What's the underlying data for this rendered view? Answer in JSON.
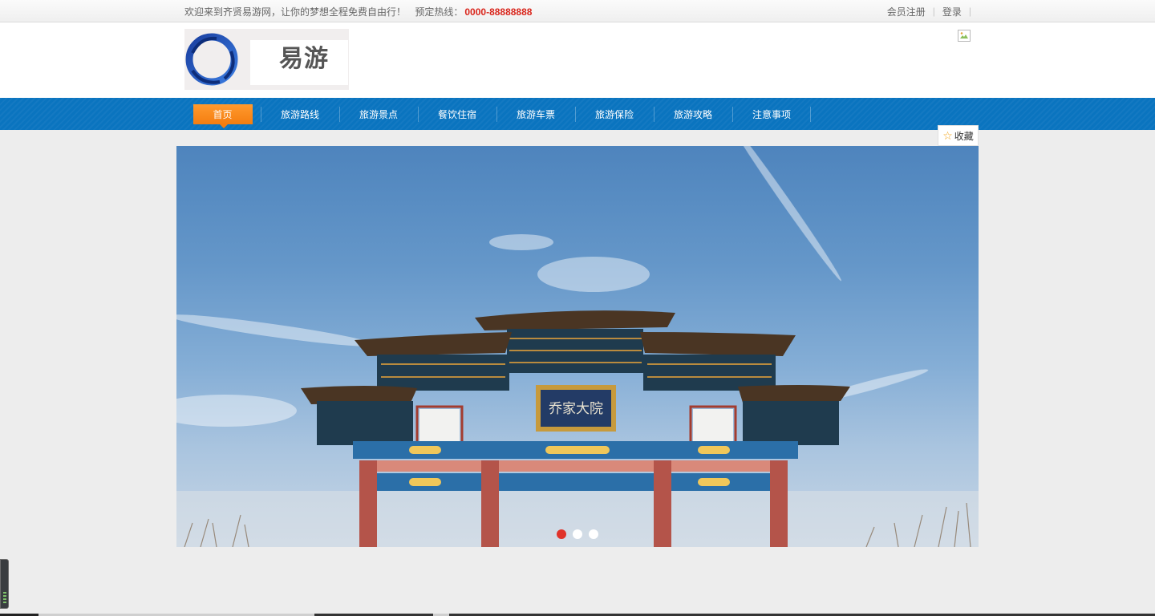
{
  "topbar": {
    "welcome": "欢迎来到齐贤易游网，让你的梦想全程免费自由行！",
    "hotline_label": "预定热线：",
    "hotline_number": "0000-88888888",
    "register": "会员注册",
    "login": "登录",
    "separator": "|"
  },
  "header": {
    "logo_text": "易游"
  },
  "nav": {
    "items": [
      {
        "label": "首页",
        "active": true
      },
      {
        "label": "旅游路线"
      },
      {
        "label": "旅游景点"
      },
      {
        "label": "餐饮住宿"
      },
      {
        "label": "旅游车票"
      },
      {
        "label": "旅游保险"
      },
      {
        "label": "旅游攻略"
      },
      {
        "label": "注意事项"
      }
    ]
  },
  "favorite": {
    "label": "收藏",
    "icon": "star-icon"
  },
  "banner": {
    "plaque_text": "乔家大院",
    "slides": 3,
    "active_slide": 1
  },
  "colors": {
    "nav_bg": "#0a74bf",
    "nav_active": "#f47d10",
    "hotline": "#d9251b",
    "dot_active": "#e0332a"
  }
}
